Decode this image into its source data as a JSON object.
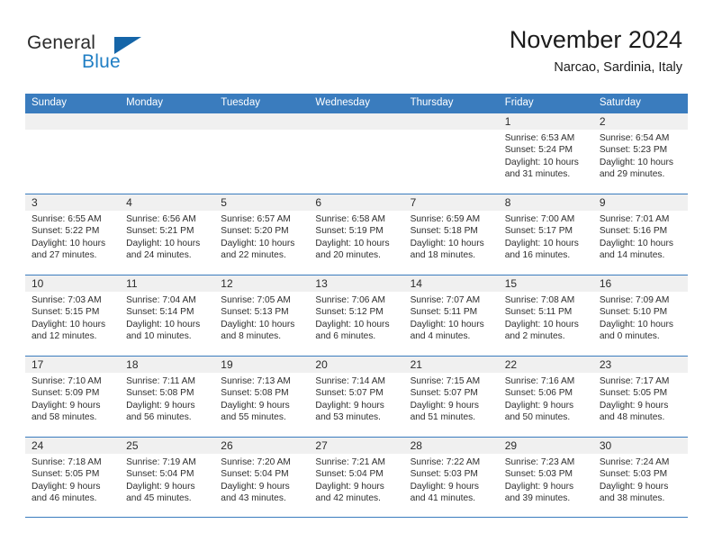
{
  "brand": {
    "name_top": "General",
    "name_bottom": "Blue",
    "accent_color": "#1f7ec4",
    "triangle_color": "#1565a8"
  },
  "header": {
    "title": "November 2024",
    "subtitle": "Narcao, Sardinia, Italy"
  },
  "theme": {
    "header_band": "#3a7cbe",
    "day_band": "#f0f0f0",
    "text": "#2e2e2e"
  },
  "weekdays": [
    "Sunday",
    "Monday",
    "Tuesday",
    "Wednesday",
    "Thursday",
    "Friday",
    "Saturday"
  ],
  "weeks": [
    [
      {
        "empty": true
      },
      {
        "empty": true
      },
      {
        "empty": true
      },
      {
        "empty": true
      },
      {
        "empty": true
      },
      {
        "day": "1",
        "sunrise": "Sunrise: 6:53 AM",
        "sunset": "Sunset: 5:24 PM",
        "daylight": "Daylight: 10 hours and 31 minutes."
      },
      {
        "day": "2",
        "sunrise": "Sunrise: 6:54 AM",
        "sunset": "Sunset: 5:23 PM",
        "daylight": "Daylight: 10 hours and 29 minutes."
      }
    ],
    [
      {
        "day": "3",
        "sunrise": "Sunrise: 6:55 AM",
        "sunset": "Sunset: 5:22 PM",
        "daylight": "Daylight: 10 hours and 27 minutes."
      },
      {
        "day": "4",
        "sunrise": "Sunrise: 6:56 AM",
        "sunset": "Sunset: 5:21 PM",
        "daylight": "Daylight: 10 hours and 24 minutes."
      },
      {
        "day": "5",
        "sunrise": "Sunrise: 6:57 AM",
        "sunset": "Sunset: 5:20 PM",
        "daylight": "Daylight: 10 hours and 22 minutes."
      },
      {
        "day": "6",
        "sunrise": "Sunrise: 6:58 AM",
        "sunset": "Sunset: 5:19 PM",
        "daylight": "Daylight: 10 hours and 20 minutes."
      },
      {
        "day": "7",
        "sunrise": "Sunrise: 6:59 AM",
        "sunset": "Sunset: 5:18 PM",
        "daylight": "Daylight: 10 hours and 18 minutes."
      },
      {
        "day": "8",
        "sunrise": "Sunrise: 7:00 AM",
        "sunset": "Sunset: 5:17 PM",
        "daylight": "Daylight: 10 hours and 16 minutes."
      },
      {
        "day": "9",
        "sunrise": "Sunrise: 7:01 AM",
        "sunset": "Sunset: 5:16 PM",
        "daylight": "Daylight: 10 hours and 14 minutes."
      }
    ],
    [
      {
        "day": "10",
        "sunrise": "Sunrise: 7:03 AM",
        "sunset": "Sunset: 5:15 PM",
        "daylight": "Daylight: 10 hours and 12 minutes."
      },
      {
        "day": "11",
        "sunrise": "Sunrise: 7:04 AM",
        "sunset": "Sunset: 5:14 PM",
        "daylight": "Daylight: 10 hours and 10 minutes."
      },
      {
        "day": "12",
        "sunrise": "Sunrise: 7:05 AM",
        "sunset": "Sunset: 5:13 PM",
        "daylight": "Daylight: 10 hours and 8 minutes."
      },
      {
        "day": "13",
        "sunrise": "Sunrise: 7:06 AM",
        "sunset": "Sunset: 5:12 PM",
        "daylight": "Daylight: 10 hours and 6 minutes."
      },
      {
        "day": "14",
        "sunrise": "Sunrise: 7:07 AM",
        "sunset": "Sunset: 5:11 PM",
        "daylight": "Daylight: 10 hours and 4 minutes."
      },
      {
        "day": "15",
        "sunrise": "Sunrise: 7:08 AM",
        "sunset": "Sunset: 5:11 PM",
        "daylight": "Daylight: 10 hours and 2 minutes."
      },
      {
        "day": "16",
        "sunrise": "Sunrise: 7:09 AM",
        "sunset": "Sunset: 5:10 PM",
        "daylight": "Daylight: 10 hours and 0 minutes."
      }
    ],
    [
      {
        "day": "17",
        "sunrise": "Sunrise: 7:10 AM",
        "sunset": "Sunset: 5:09 PM",
        "daylight": "Daylight: 9 hours and 58 minutes."
      },
      {
        "day": "18",
        "sunrise": "Sunrise: 7:11 AM",
        "sunset": "Sunset: 5:08 PM",
        "daylight": "Daylight: 9 hours and 56 minutes."
      },
      {
        "day": "19",
        "sunrise": "Sunrise: 7:13 AM",
        "sunset": "Sunset: 5:08 PM",
        "daylight": "Daylight: 9 hours and 55 minutes."
      },
      {
        "day": "20",
        "sunrise": "Sunrise: 7:14 AM",
        "sunset": "Sunset: 5:07 PM",
        "daylight": "Daylight: 9 hours and 53 minutes."
      },
      {
        "day": "21",
        "sunrise": "Sunrise: 7:15 AM",
        "sunset": "Sunset: 5:07 PM",
        "daylight": "Daylight: 9 hours and 51 minutes."
      },
      {
        "day": "22",
        "sunrise": "Sunrise: 7:16 AM",
        "sunset": "Sunset: 5:06 PM",
        "daylight": "Daylight: 9 hours and 50 minutes."
      },
      {
        "day": "23",
        "sunrise": "Sunrise: 7:17 AM",
        "sunset": "Sunset: 5:05 PM",
        "daylight": "Daylight: 9 hours and 48 minutes."
      }
    ],
    [
      {
        "day": "24",
        "sunrise": "Sunrise: 7:18 AM",
        "sunset": "Sunset: 5:05 PM",
        "daylight": "Daylight: 9 hours and 46 minutes."
      },
      {
        "day": "25",
        "sunrise": "Sunrise: 7:19 AM",
        "sunset": "Sunset: 5:04 PM",
        "daylight": "Daylight: 9 hours and 45 minutes."
      },
      {
        "day": "26",
        "sunrise": "Sunrise: 7:20 AM",
        "sunset": "Sunset: 5:04 PM",
        "daylight": "Daylight: 9 hours and 43 minutes."
      },
      {
        "day": "27",
        "sunrise": "Sunrise: 7:21 AM",
        "sunset": "Sunset: 5:04 PM",
        "daylight": "Daylight: 9 hours and 42 minutes."
      },
      {
        "day": "28",
        "sunrise": "Sunrise: 7:22 AM",
        "sunset": "Sunset: 5:03 PM",
        "daylight": "Daylight: 9 hours and 41 minutes."
      },
      {
        "day": "29",
        "sunrise": "Sunrise: 7:23 AM",
        "sunset": "Sunset: 5:03 PM",
        "daylight": "Daylight: 9 hours and 39 minutes."
      },
      {
        "day": "30",
        "sunrise": "Sunrise: 7:24 AM",
        "sunset": "Sunset: 5:03 PM",
        "daylight": "Daylight: 9 hours and 38 minutes."
      }
    ]
  ]
}
